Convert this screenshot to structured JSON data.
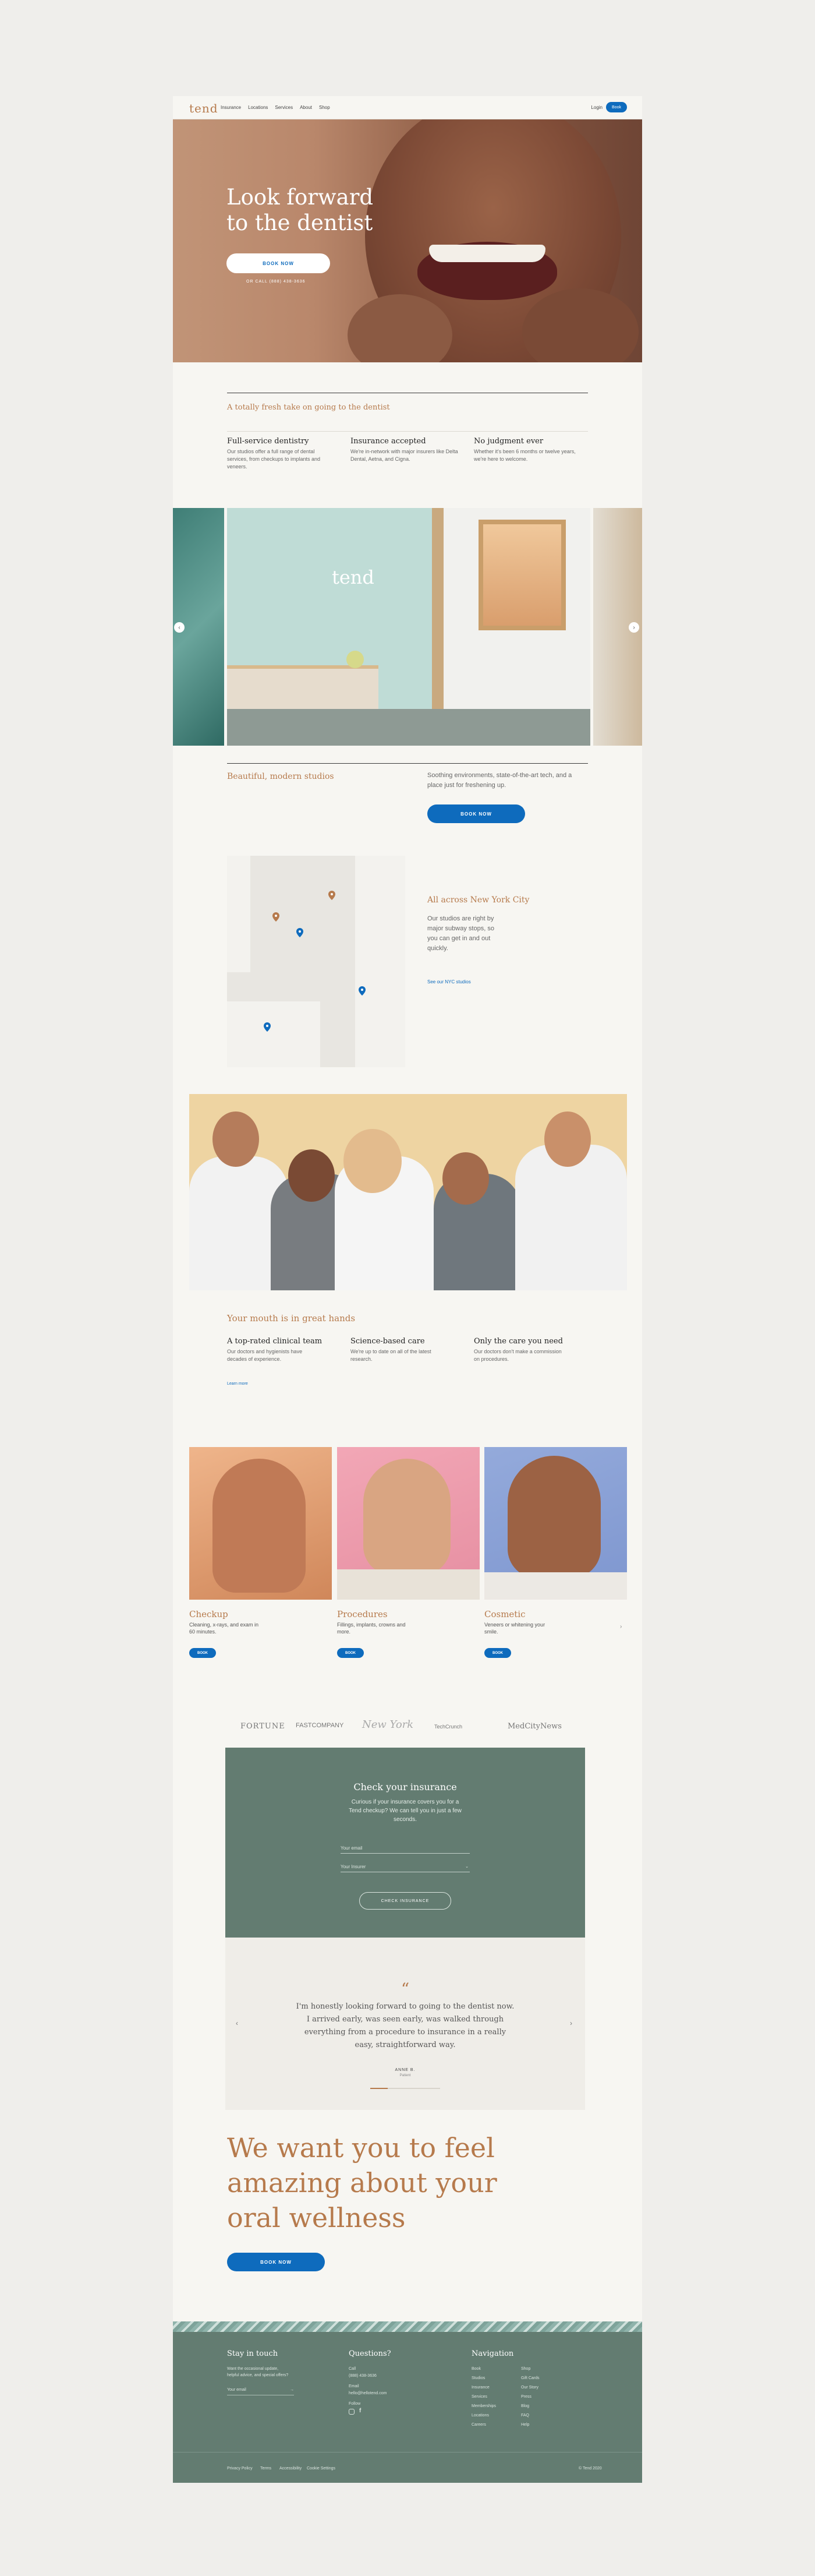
{
  "nav": {
    "logo": "tend",
    "links": [
      "Insurance",
      "Locations",
      "Services",
      "About",
      "Shop"
    ],
    "login": "Login",
    "book": "Book"
  },
  "hero": {
    "title": "Look forward to the dentist",
    "button": "BOOK NOW",
    "call": "OR CALL  (888) 438-3636"
  },
  "fresh": {
    "title": "A totally fresh take on going to the dentist",
    "features": [
      {
        "title": "Full-service dentistry",
        "text": "Our studios offer a full range of dental services, from checkups to implants and veneers."
      },
      {
        "title": "Insurance accepted",
        "text": "We're in-network with major insurers like Delta Dental, Aetna, and Cigna."
      },
      {
        "title": "No judgment ever",
        "text": "Whether it's been 6 months or twelve years, we're here to welcome."
      }
    ]
  },
  "gallery": {
    "sign": "tend",
    "prev": "‹",
    "next": "›"
  },
  "studios": {
    "title": "Beautiful, modern studios",
    "text": "Soothing environments, state-of-the-art tech, and a place just for freshening up.",
    "button": "BOOK NOW"
  },
  "locations": {
    "title": "All across New York City",
    "text": "Our studios are right by major subway stops, so you can get in and out quickly.",
    "link": "See our NYC studios"
  },
  "team": {
    "title": "Your mouth is in great hands",
    "features": [
      {
        "title": "A top-rated clinical team",
        "text": "Our doctors and hygienists have decades of experience."
      },
      {
        "title": "Science-based care",
        "text": "We're up to date on all of the latest research."
      },
      {
        "title": "Only the care you need",
        "text": "Our doctors don't make a commission on procedures."
      }
    ],
    "link": "Learn more"
  },
  "services": [
    {
      "title": "Checkup",
      "text": "Cleaning, x-rays, and exam in 60 minutes.",
      "button": "BOOK"
    },
    {
      "title": "Procedures",
      "text": "Fillings, implants, crowns and more.",
      "button": "BOOK"
    },
    {
      "title": "Cosmetic",
      "text": "Veneers or whitening your smile.",
      "button": "BOOK"
    }
  ],
  "services_next": "›",
  "press": [
    "FORTUNE",
    "FASTCOMPANY",
    "New York",
    "TechCrunch",
    "MedCityNews"
  ],
  "insurance": {
    "title": "Check your insurance",
    "text": "Curious if your insurance covers you for a Tend checkup? We can tell you in just a few seconds.",
    "field1": "Your email",
    "field2": "Your Insurer",
    "button": "CHECK INSURANCE"
  },
  "testimonial": {
    "quote_mark": "“",
    "quote": "I'm honestly looking forward to going to the dentist now. I arrived early, was seen early, was walked through everything from a procedure to insurance in a really easy, straightforward way.",
    "name": "ANNE B.",
    "sub": "Patient",
    "prev": "‹",
    "next": "›"
  },
  "closing": {
    "headline": "We want you to feel amazing about your oral wellness",
    "button": "BOOK NOW"
  },
  "footer": {
    "stay_title": "Stay in touch",
    "stay_text": "Want the occasional update, helpful advice, and special offers?",
    "stay_field": "Your email",
    "questions_title": "Questions?",
    "questions_lines": [
      "Call",
      "(888) 438-3636",
      "Email",
      "hello@hellotend.com",
      "Follow"
    ],
    "nav_title": "Navigation",
    "nav_col1": [
      "Book",
      "Studios",
      "Insurance",
      "Services",
      "Memberships",
      "Locations",
      "Careers"
    ],
    "nav_col2": [
      "Shop",
      "Gift Cards",
      "Our Story",
      "Press",
      "Blog",
      "FAQ",
      "Help"
    ],
    "bottom_links": [
      "Privacy Policy",
      "Terms",
      "Accessibility",
      "Cookie Settings"
    ],
    "copyright": "© Tend 2020"
  },
  "colors": {
    "accent": "#b67a4c",
    "primary": "#0e6bbd",
    "green": "#637c71",
    "bg": "#f7f6f2"
  }
}
